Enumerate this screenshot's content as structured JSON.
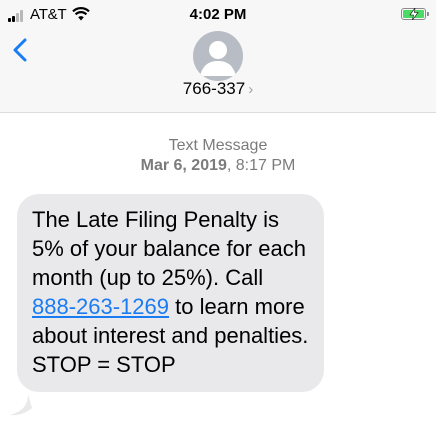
{
  "status_bar": {
    "carrier": "AT&T",
    "time": "4:02 PM",
    "battery_color": "#4cd964"
  },
  "header": {
    "back_icon": "chevron-left-icon",
    "avatar_icon": "person-icon",
    "contact": "766-337",
    "contact_chevron": "›"
  },
  "thread": {
    "type_label": "Text Message",
    "date_bold": "Mar 6, 2019",
    "date_sep": ", ",
    "time": "8:17 PM"
  },
  "message": {
    "text_before": "The Late Filing Penalty is 5% of your balance for each month (up to 25%). Call ",
    "phone_link": "888-263-1269",
    "text_after": " to learn more about interest and penalties. STOP = STOP"
  },
  "colors": {
    "link": "#1a7cf2",
    "bubble": "#e9e9eb",
    "back_chevron": "#1a7cf2"
  }
}
